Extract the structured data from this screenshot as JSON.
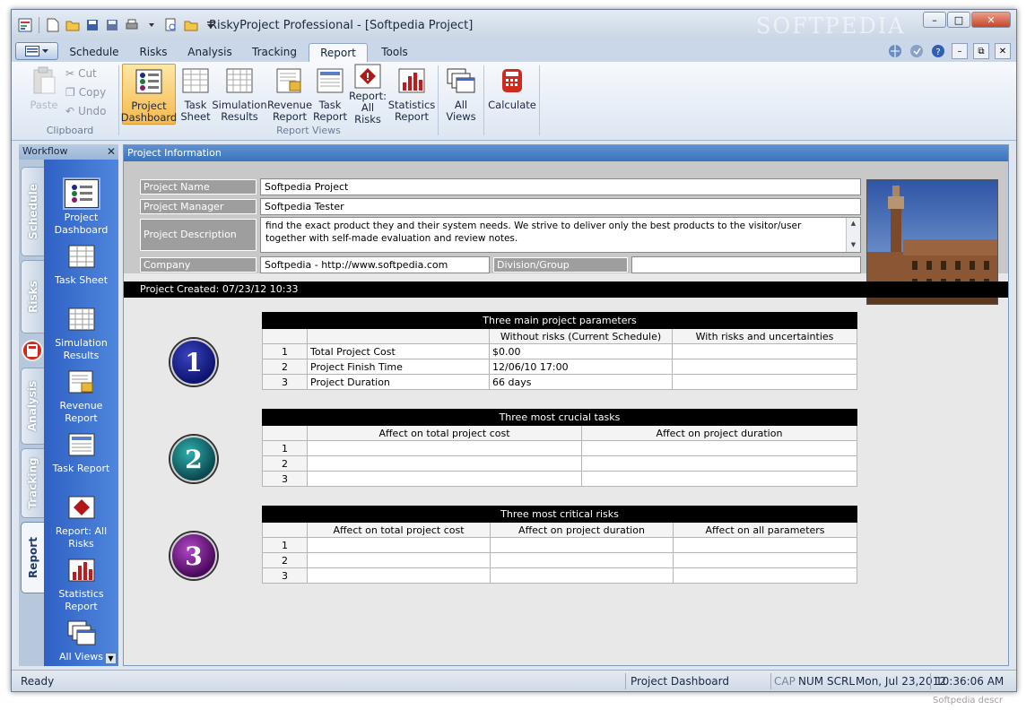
{
  "window": {
    "title": "RiskyProject Professional - [Softpedia Project]",
    "watermark": "SOFTPEDIA"
  },
  "tabs": [
    "Schedule",
    "Risks",
    "Analysis",
    "Tracking",
    "Report",
    "Tools"
  ],
  "active_tab": "Report",
  "clipboard": {
    "paste": "Paste",
    "cut": "Cut",
    "copy": "Copy",
    "undo": "Undo",
    "group": "Clipboard"
  },
  "report_views": {
    "group": "Report Views",
    "buttons": [
      {
        "l1": "Project",
        "l2": "Dashboard"
      },
      {
        "l1": "Task",
        "l2": "Sheet"
      },
      {
        "l1": "Simulation",
        "l2": "Results"
      },
      {
        "l1": "Revenue",
        "l2": "Report"
      },
      {
        "l1": "Task",
        "l2": "Report"
      },
      {
        "l1": "Report:",
        "l2": "All Risks"
      },
      {
        "l1": "Statistics",
        "l2": "Report"
      }
    ],
    "all_views": {
      "l1": "All",
      "l2": "Views"
    },
    "calculate": "Calculate"
  },
  "workflow": {
    "title": "Workflow",
    "vtabs": [
      "Schedule",
      "Risks",
      "Analysis",
      "Tracking",
      "Report"
    ],
    "items": [
      {
        "l1": "Project",
        "l2": "Dashboard"
      },
      {
        "l1": "Task Sheet",
        "l2": ""
      },
      {
        "l1": "Simulation",
        "l2": "Results"
      },
      {
        "l1": "Revenue",
        "l2": "Report"
      },
      {
        "l1": "Task Report",
        "l2": ""
      },
      {
        "l1": "Report: All",
        "l2": "Risks"
      },
      {
        "l1": "Statistics",
        "l2": "Report"
      },
      {
        "l1": "All Views",
        "l2": ""
      }
    ]
  },
  "project_info": {
    "header": "Project Information",
    "labels": {
      "name": "Project Name",
      "manager": "Project Manager",
      "description": "Project Description",
      "company": "Company",
      "division": "Division/Group"
    },
    "values": {
      "name": "Softpedia Project",
      "manager": "Softpedia Tester",
      "description": "find the exact product they and their system needs. We strive to deliver only the best products to the visitor/user together with self-made evaluation and review notes.",
      "company": "Softpedia - http://www.softpedia.com",
      "division": ""
    },
    "created": "Project Created: 07/23/12 10:33"
  },
  "sections": {
    "s1": {
      "num": "1",
      "caption": "Three main project parameters",
      "col1": "Without risks (Current Schedule)",
      "col2": "With risks and uncertainties",
      "rows": [
        {
          "n": "1",
          "name": "Total Project Cost",
          "v1": "$0.00",
          "v2": ""
        },
        {
          "n": "2",
          "name": "Project Finish Time",
          "v1": "12/06/10 17:00",
          "v2": ""
        },
        {
          "n": "3",
          "name": "Project Duration",
          "v1": "66 days",
          "v2": ""
        }
      ]
    },
    "s2": {
      "num": "2",
      "caption": "Three most crucial tasks",
      "col1": "Affect on total project cost",
      "col2": "Affect on project duration",
      "rows": [
        "1",
        "2",
        "3"
      ]
    },
    "s3": {
      "num": "3",
      "caption": "Three most critical risks",
      "col1": "Affect on total project cost",
      "col2": "Affect on project duration",
      "col3": "Affect on all parameters",
      "rows": [
        "1",
        "2",
        "3"
      ]
    }
  },
  "status": {
    "left": "Ready",
    "view": "Project Dashboard",
    "cap": "CAP",
    "num": "NUM",
    "scrl": "SCRL",
    "date": "Mon, Jul 23,2012",
    "time": "10:36:06 AM",
    "watermark": "Softpedia descr"
  }
}
